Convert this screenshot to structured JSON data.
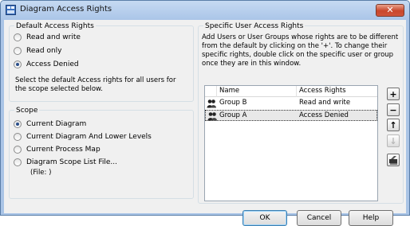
{
  "window": {
    "title": "Diagram Access Rights",
    "close_label": "✕"
  },
  "default_rights": {
    "title": "Default Access Rights",
    "options": [
      "Read and write",
      "Read only",
      "Access Denied"
    ],
    "selected": "Access Denied",
    "description": "Select the default Access rights for all users for the scope selected below."
  },
  "scope": {
    "title": "Scope",
    "options": [
      "Current Diagram",
      "Current Diagram And Lower Levels",
      "Current Process Map",
      "Diagram Scope List File..."
    ],
    "selected": "Current Diagram",
    "file_label": "(File: )"
  },
  "specific": {
    "title": "Specific User Access Rights",
    "description": "Add Users or User Groups whose rights are to be different from the default by clicking on the '+'. To change their specific rights, double click on the specific user or group once they are in this window.",
    "columns": [
      "Name",
      "Access Rights"
    ],
    "rows": [
      {
        "name": "Group B",
        "rights": "Read and write"
      },
      {
        "name": "Group A",
        "rights": "Access Denied"
      }
    ]
  },
  "side_buttons": {
    "add": "+",
    "remove": "−",
    "up": "↑",
    "down": "↓"
  },
  "buttons": {
    "ok": "OK",
    "cancel": "Cancel",
    "help": "Help"
  }
}
